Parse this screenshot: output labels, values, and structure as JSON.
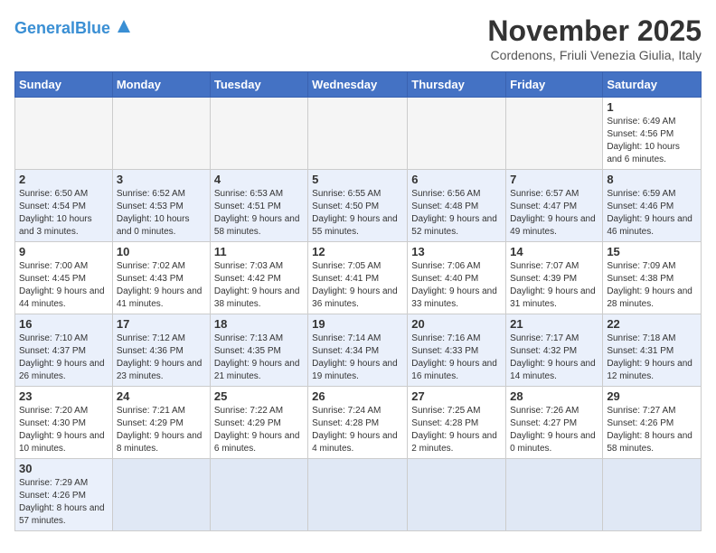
{
  "header": {
    "logo_general": "General",
    "logo_blue": "Blue",
    "month_title": "November 2025",
    "subtitle": "Cordenons, Friuli Venezia Giulia, Italy"
  },
  "weekdays": [
    "Sunday",
    "Monday",
    "Tuesday",
    "Wednesday",
    "Thursday",
    "Friday",
    "Saturday"
  ],
  "weeks": [
    [
      {
        "day": "",
        "info": ""
      },
      {
        "day": "",
        "info": ""
      },
      {
        "day": "",
        "info": ""
      },
      {
        "day": "",
        "info": ""
      },
      {
        "day": "",
        "info": ""
      },
      {
        "day": "",
        "info": ""
      },
      {
        "day": "1",
        "info": "Sunrise: 6:49 AM\nSunset: 4:56 PM\nDaylight: 10 hours and 6 minutes."
      }
    ],
    [
      {
        "day": "2",
        "info": "Sunrise: 6:50 AM\nSunset: 4:54 PM\nDaylight: 10 hours and 3 minutes."
      },
      {
        "day": "3",
        "info": "Sunrise: 6:52 AM\nSunset: 4:53 PM\nDaylight: 10 hours and 0 minutes."
      },
      {
        "day": "4",
        "info": "Sunrise: 6:53 AM\nSunset: 4:51 PM\nDaylight: 9 hours and 58 minutes."
      },
      {
        "day": "5",
        "info": "Sunrise: 6:55 AM\nSunset: 4:50 PM\nDaylight: 9 hours and 55 minutes."
      },
      {
        "day": "6",
        "info": "Sunrise: 6:56 AM\nSunset: 4:48 PM\nDaylight: 9 hours and 52 minutes."
      },
      {
        "day": "7",
        "info": "Sunrise: 6:57 AM\nSunset: 4:47 PM\nDaylight: 9 hours and 49 minutes."
      },
      {
        "day": "8",
        "info": "Sunrise: 6:59 AM\nSunset: 4:46 PM\nDaylight: 9 hours and 46 minutes."
      }
    ],
    [
      {
        "day": "9",
        "info": "Sunrise: 7:00 AM\nSunset: 4:45 PM\nDaylight: 9 hours and 44 minutes."
      },
      {
        "day": "10",
        "info": "Sunrise: 7:02 AM\nSunset: 4:43 PM\nDaylight: 9 hours and 41 minutes."
      },
      {
        "day": "11",
        "info": "Sunrise: 7:03 AM\nSunset: 4:42 PM\nDaylight: 9 hours and 38 minutes."
      },
      {
        "day": "12",
        "info": "Sunrise: 7:05 AM\nSunset: 4:41 PM\nDaylight: 9 hours and 36 minutes."
      },
      {
        "day": "13",
        "info": "Sunrise: 7:06 AM\nSunset: 4:40 PM\nDaylight: 9 hours and 33 minutes."
      },
      {
        "day": "14",
        "info": "Sunrise: 7:07 AM\nSunset: 4:39 PM\nDaylight: 9 hours and 31 minutes."
      },
      {
        "day": "15",
        "info": "Sunrise: 7:09 AM\nSunset: 4:38 PM\nDaylight: 9 hours and 28 minutes."
      }
    ],
    [
      {
        "day": "16",
        "info": "Sunrise: 7:10 AM\nSunset: 4:37 PM\nDaylight: 9 hours and 26 minutes."
      },
      {
        "day": "17",
        "info": "Sunrise: 7:12 AM\nSunset: 4:36 PM\nDaylight: 9 hours and 23 minutes."
      },
      {
        "day": "18",
        "info": "Sunrise: 7:13 AM\nSunset: 4:35 PM\nDaylight: 9 hours and 21 minutes."
      },
      {
        "day": "19",
        "info": "Sunrise: 7:14 AM\nSunset: 4:34 PM\nDaylight: 9 hours and 19 minutes."
      },
      {
        "day": "20",
        "info": "Sunrise: 7:16 AM\nSunset: 4:33 PM\nDaylight: 9 hours and 16 minutes."
      },
      {
        "day": "21",
        "info": "Sunrise: 7:17 AM\nSunset: 4:32 PM\nDaylight: 9 hours and 14 minutes."
      },
      {
        "day": "22",
        "info": "Sunrise: 7:18 AM\nSunset: 4:31 PM\nDaylight: 9 hours and 12 minutes."
      }
    ],
    [
      {
        "day": "23",
        "info": "Sunrise: 7:20 AM\nSunset: 4:30 PM\nDaylight: 9 hours and 10 minutes."
      },
      {
        "day": "24",
        "info": "Sunrise: 7:21 AM\nSunset: 4:29 PM\nDaylight: 9 hours and 8 minutes."
      },
      {
        "day": "25",
        "info": "Sunrise: 7:22 AM\nSunset: 4:29 PM\nDaylight: 9 hours and 6 minutes."
      },
      {
        "day": "26",
        "info": "Sunrise: 7:24 AM\nSunset: 4:28 PM\nDaylight: 9 hours and 4 minutes."
      },
      {
        "day": "27",
        "info": "Sunrise: 7:25 AM\nSunset: 4:28 PM\nDaylight: 9 hours and 2 minutes."
      },
      {
        "day": "28",
        "info": "Sunrise: 7:26 AM\nSunset: 4:27 PM\nDaylight: 9 hours and 0 minutes."
      },
      {
        "day": "29",
        "info": "Sunrise: 7:27 AM\nSunset: 4:26 PM\nDaylight: 8 hours and 58 minutes."
      }
    ],
    [
      {
        "day": "30",
        "info": "Sunrise: 7:29 AM\nSunset: 4:26 PM\nDaylight: 8 hours and 57 minutes."
      },
      {
        "day": "",
        "info": ""
      },
      {
        "day": "",
        "info": ""
      },
      {
        "day": "",
        "info": ""
      },
      {
        "day": "",
        "info": ""
      },
      {
        "day": "",
        "info": ""
      },
      {
        "day": "",
        "info": ""
      }
    ]
  ]
}
